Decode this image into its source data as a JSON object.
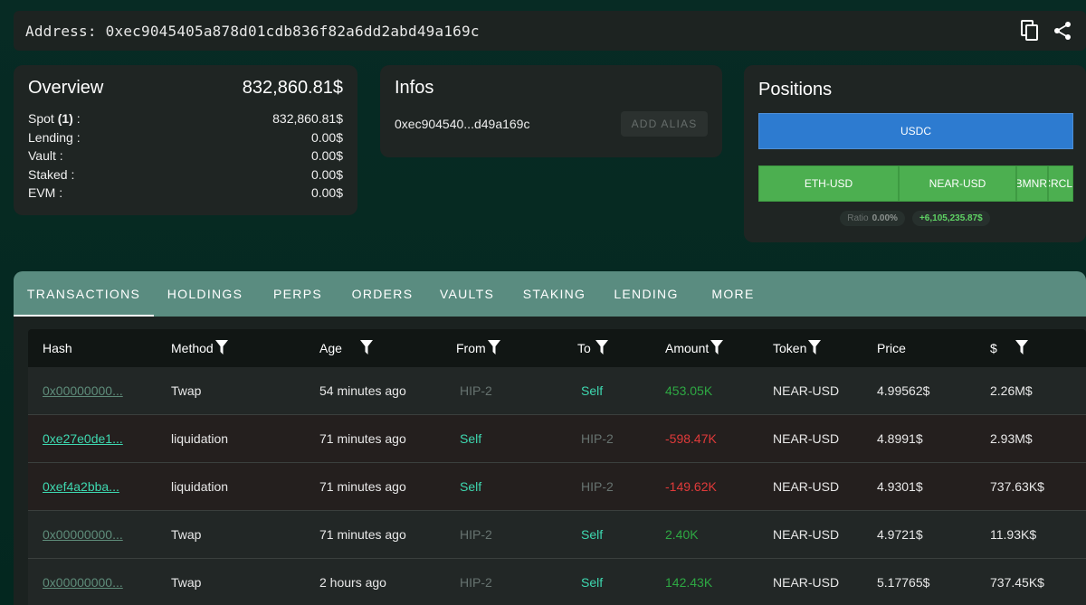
{
  "address": {
    "label": "Address:",
    "value": "0xec9045405a878d01cdb836f82a6dd2abd49a169c",
    "copy_icon": "copy-icon",
    "share_icon": "share-icon"
  },
  "overview": {
    "title": "Overview",
    "total": "832,860.81$",
    "rows": [
      {
        "label": "Spot ",
        "count": "(1)",
        "suffix": " :",
        "value": "832,860.81$"
      },
      {
        "label": "Lending :",
        "count": "",
        "suffix": "",
        "value": "0.00$"
      },
      {
        "label": "Vault :",
        "count": "",
        "suffix": "",
        "value": "0.00$"
      },
      {
        "label": "Staked :",
        "count": "",
        "suffix": "",
        "value": "0.00$"
      },
      {
        "label": "EVM :",
        "count": "",
        "suffix": "",
        "value": "0.00$"
      }
    ]
  },
  "infos": {
    "title": "Infos",
    "short_address": "0xec904540...d49a169c",
    "add_alias": "ADD ALIAS"
  },
  "positions": {
    "title": "Positions",
    "spot": [
      {
        "label": "USDC"
      }
    ],
    "perps": [
      {
        "label": "ETH-USD"
      },
      {
        "label": "NEAR-USD"
      },
      {
        "label": "BMNR"
      },
      {
        "label": "CRCL"
      }
    ],
    "ratio_label": "Ratio",
    "ratio_value": "0.00%",
    "pnl": "+6,105,235.87$"
  },
  "tabs": [
    "TRANSACTIONS",
    "HOLDINGS",
    "PERPS",
    "ORDERS",
    "VAULTS",
    "STAKING",
    "LENDING",
    "MORE"
  ],
  "active_tab": "TRANSACTIONS",
  "table": {
    "columns": [
      "Hash",
      "Method",
      "Age",
      "From",
      "To",
      "Amount",
      "Token",
      "Price",
      "$"
    ],
    "rows": [
      {
        "hash": "0x00000000...",
        "method": "Twap",
        "age": "54 minutes ago",
        "from": "HIP-2",
        "to": "Self",
        "amount": "453.05K",
        "token": "NEAR-USD",
        "price": "4.99562$",
        "usd": "2.26M$"
      },
      {
        "hash": "0xe27e0de1...",
        "method": "liquidation",
        "age": "71 minutes ago",
        "from": "Self",
        "to": "HIP-2",
        "amount": "-598.47K",
        "token": "NEAR-USD",
        "price": "4.8991$",
        "usd": "2.93M$"
      },
      {
        "hash": "0xef4a2bba...",
        "method": "liquidation",
        "age": "71 minutes ago",
        "from": "Self",
        "to": "HIP-2",
        "amount": "-149.62K",
        "token": "NEAR-USD",
        "price": "4.9301$",
        "usd": "737.63K$"
      },
      {
        "hash": "0x00000000...",
        "method": "Twap",
        "age": "71 minutes ago",
        "from": "HIP-2",
        "to": "Self",
        "amount": "2.40K",
        "token": "NEAR-USD",
        "price": "4.9721$",
        "usd": "11.93K$"
      },
      {
        "hash": "0x00000000...",
        "method": "Twap",
        "age": "2 hours ago",
        "from": "HIP-2",
        "to": "Self",
        "amount": "142.43K",
        "token": "NEAR-USD",
        "price": "5.17765$",
        "usd": "737.45K$"
      }
    ]
  },
  "colors": {
    "background": "#03261f",
    "tab_bar": "#5a8c80",
    "positive": "#2ea843",
    "negative": "#e03a3a",
    "self_link": "#3ed8b0",
    "usdc_bar": "#2d7bd0",
    "perp_bar": "#4caf50"
  }
}
